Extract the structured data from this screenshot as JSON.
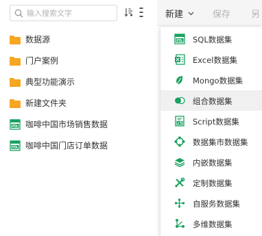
{
  "search": {
    "placeholder": "输入搜索文字",
    "value": ""
  },
  "tree": {
    "items": [
      {
        "label": "数据源",
        "icon": "folder-icon"
      },
      {
        "label": "门户案例",
        "icon": "folder-icon"
      },
      {
        "label": "典型功能演示",
        "icon": "folder-icon"
      },
      {
        "label": "新建文件夹",
        "icon": "folder-icon"
      },
      {
        "label": "咖啡中国市场销售数据",
        "icon": "sql-dataset-icon"
      },
      {
        "label": "咖啡中国门店订单数据",
        "icon": "sql-dataset-icon"
      }
    ]
  },
  "toolbar": {
    "new_label": "新建",
    "save_label": "保存",
    "saveas_label": "另"
  },
  "menu": {
    "items": [
      {
        "label": "SQL数据集",
        "icon": "sql-icon"
      },
      {
        "label": "Excel数据集",
        "icon": "excel-icon"
      },
      {
        "label": "Mongo数据集",
        "icon": "mongo-leaf-icon"
      },
      {
        "label": "组合数据集",
        "icon": "combine-icon"
      },
      {
        "label": "Script数据集",
        "icon": "script-js-icon"
      },
      {
        "label": "数据集市数据集",
        "icon": "datamart-icon"
      },
      {
        "label": "内嵌数据集",
        "icon": "embedded-layers-icon"
      },
      {
        "label": "定制数据集",
        "icon": "custom-tools-icon"
      },
      {
        "label": "自服务数据集",
        "icon": "self-service-icon"
      },
      {
        "label": "多维数据集",
        "icon": "multidimensional-icon"
      }
    ]
  },
  "colors": {
    "accent_green": "#1aa161",
    "folder_orange": "#f5a623",
    "toolbar_bg": "#f5f5f5",
    "hover_bg": "#f0f0f0"
  }
}
